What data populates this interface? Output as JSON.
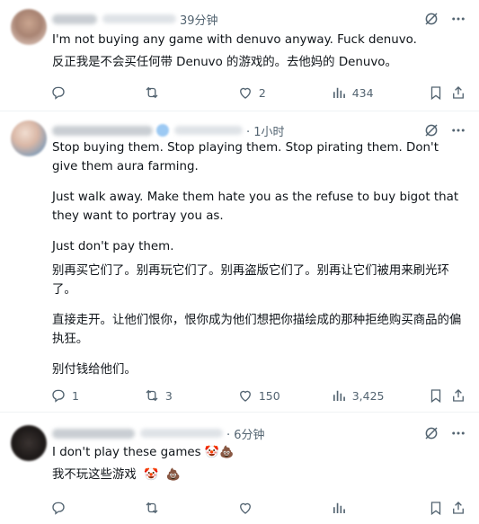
{
  "tweets": [
    {
      "time": "39分钟",
      "lines": [
        "I'm not buying any game with denuvo anyway. Fuck denuvo.",
        "反正我是不会买任何带 Denuvo 的游戏的。去他妈的 Denuvo。"
      ],
      "replies": "",
      "retweets": "",
      "likes": "2",
      "views": "434"
    },
    {
      "time": "· 1小时",
      "paragraphs": [
        "Stop buying them. Stop playing them. Stop pirating them. Don't give them aura farming.",
        "Just walk away. Make them hate you as the refuse to buy bigot that they want to portray you as.",
        "Just don't pay them.",
        "别再买它们了。别再玩它们了。别再盗版它们了。别再让它们被用来刷光环了。",
        "直接走开。让他们恨你，恨你成为他们想把你描绘成的那种拒绝购买商品的偏执狂。",
        "别付钱给他们。"
      ],
      "replies": "1",
      "retweets": "3",
      "likes": "150",
      "views": "3,425"
    },
    {
      "time": "· 6分钟",
      "line1_text": "I don't play these games",
      "line2_text": "我不玩这些游戏",
      "emoji_clown": "🤡",
      "emoji_poop": "💩",
      "replies": "",
      "retweets": "",
      "likes": "",
      "views": ""
    }
  ],
  "icons": {
    "grok": "grok-icon",
    "more": "more-icon",
    "reply": "reply-icon",
    "retweet": "retweet-icon",
    "like": "like-icon",
    "views": "views-icon",
    "bookmark": "bookmark-icon",
    "share": "share-icon"
  },
  "colors": {
    "text": "#0f1419",
    "secondary": "#536471",
    "divider": "#eff3f4"
  }
}
